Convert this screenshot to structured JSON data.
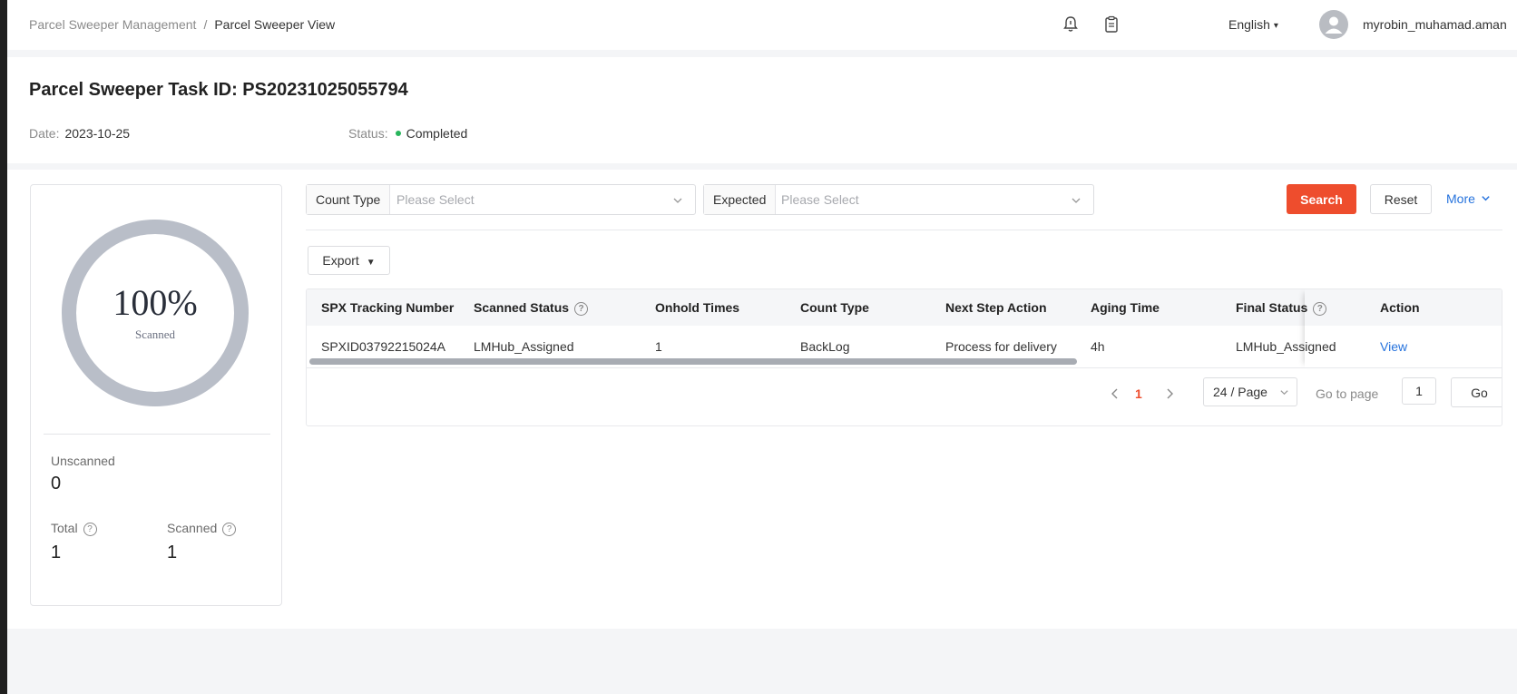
{
  "breadcrumb": {
    "parent": "Parcel Sweeper Management",
    "separator": "/",
    "current": "Parcel Sweeper View"
  },
  "topbar": {
    "icons": [
      "bell-icon",
      "clipboard-icon"
    ],
    "language": "English",
    "username": "myrobin_muhamad.aman"
  },
  "task": {
    "title": "Parcel Sweeper Task ID: PS20231025055794",
    "date_label": "Date:",
    "date_value": "2023-10-25",
    "status_label": "Status:",
    "status_value": "Completed",
    "status_color": "#28b55c"
  },
  "summary": {
    "percent_text": "100%",
    "percent_value": 100,
    "percent_caption": "Scanned",
    "ring_color": "#b9bec8",
    "unscanned_label": "Unscanned",
    "unscanned_value": "0",
    "total_label": "Total",
    "total_value": "1",
    "scanned_label": "Scanned",
    "scanned_value": "1"
  },
  "filters": {
    "count_type_label": "Count Type",
    "count_type_placeholder": "Please Select",
    "expected_label": "Expected",
    "expected_placeholder": "Please Select",
    "search_label": "Search",
    "reset_label": "Reset",
    "more_label": "More",
    "accent_color": "#ee4d2d"
  },
  "export_label": "Export",
  "table": {
    "columns": [
      "SPX Tracking Number",
      "Scanned Status",
      "Onhold Times",
      "Count Type",
      "Next Step Action",
      "Aging Time",
      "Final Status",
      "Action"
    ],
    "rows": [
      [
        "SPXID03792215024A",
        "LMHub_Assigned",
        "1",
        "BackLog",
        "Process for delivery",
        "4h",
        "LMHub_Assigned",
        "View"
      ]
    ]
  },
  "pagination": {
    "current_page": "1",
    "page_size": "24 / Page",
    "goto_label": "Go to page",
    "goto_value": "1",
    "go_label": "Go"
  }
}
